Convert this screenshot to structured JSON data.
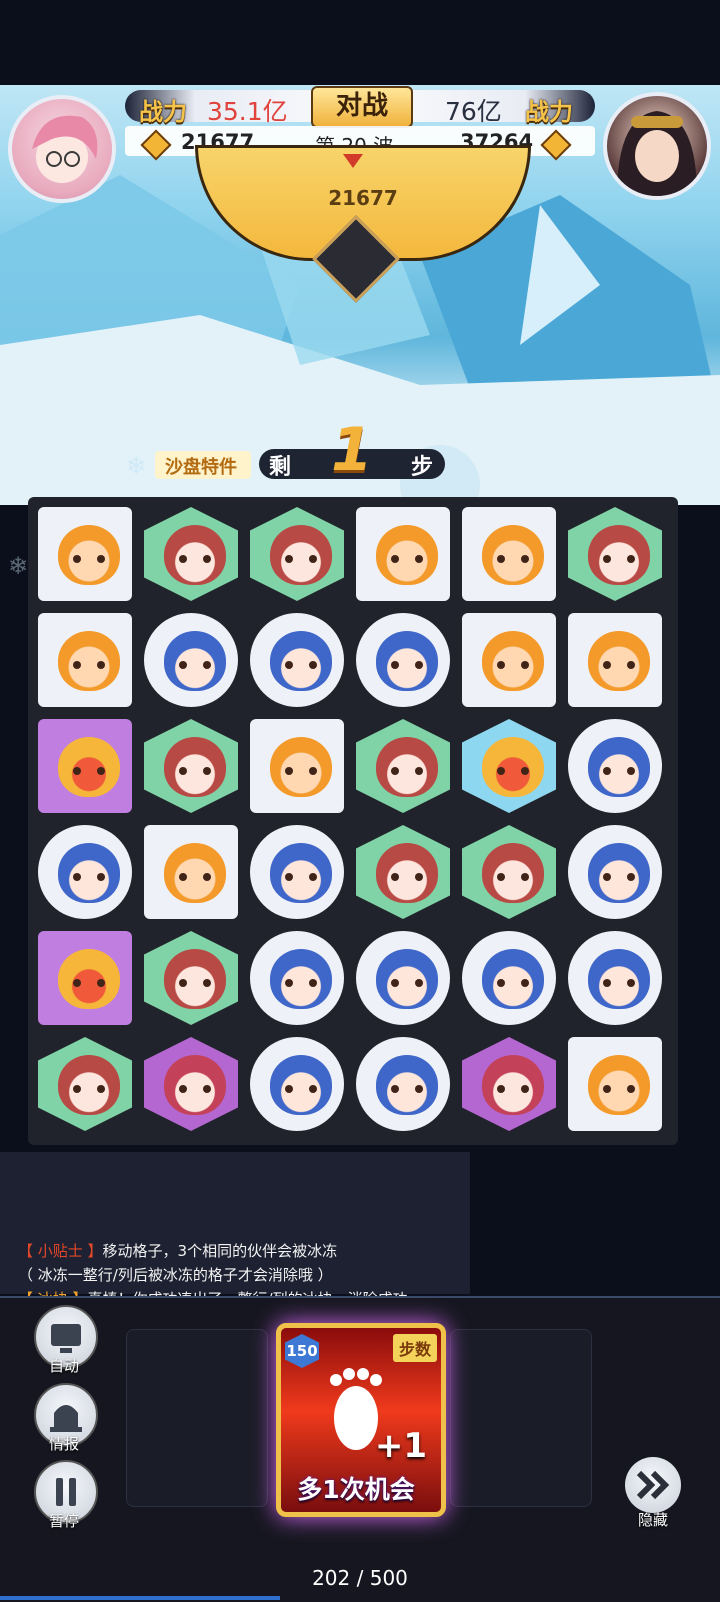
{
  "hud": {
    "power_label_left": "战力",
    "power_left": "35.1亿",
    "vs_label": "对战",
    "power_right": "76亿",
    "power_label_right": "战力",
    "score_left": "21677",
    "wave": "第 20 波",
    "score_right": "37264",
    "shield_value": "21677"
  },
  "steps": {
    "feature_label": "沙盘特件",
    "remaining_prefix": "剩",
    "remaining_count": "1",
    "remaining_suffix": "步"
  },
  "board": {
    "rows": 6,
    "cols": 6,
    "tiles": [
      [
        "orange-sq",
        "red-hex",
        "red-hex",
        "orange-sq",
        "orange-sq",
        "red-hex"
      ],
      [
        "orange-sq",
        "blue-ci",
        "blue-ci",
        "blue-ci",
        "orange-sq",
        "orange-sq"
      ],
      [
        "gold-sq",
        "red-hex",
        "orange-sq",
        "red-hex",
        "gold-hex",
        "blue-ci"
      ],
      [
        "blue-ci",
        "orange-sq",
        "blue-ci",
        "red-hex",
        "red-hex",
        "blue-ci"
      ],
      [
        "gold-sq",
        "red-hex",
        "blue-ci",
        "blue-ci",
        "blue-ci",
        "blue-ci"
      ],
      [
        "red-hex",
        "pink-hex",
        "blue-ci",
        "blue-ci",
        "pink-hex",
        "orange-sq"
      ]
    ],
    "tile_colors": {
      "orange-sq": "#eef1f8",
      "red-hex": "#7fd3a6",
      "blue-ci": "#eef1f8",
      "gold-sq": "#c07ee0",
      "gold-hex": "#8ed7f0",
      "pink-hex": "#b466d1"
    }
  },
  "tips": {
    "tip_label": "【 小贴士 】",
    "tip_text": "移动格子，3个相同的伙伴会被冰冻",
    "tip_text2": "（ 冰冻一整行/列后被冰冻的格子才会消除哦 ）",
    "ice_label": "【 冰块 】",
    "ice_text": "真棒！你成功凑出了一整行/列的冰块，消除成功"
  },
  "controls": {
    "auto_label": "自动",
    "info_label": "情报",
    "pause_label": "暂停",
    "hide_label": "隐藏"
  },
  "card": {
    "level": "150",
    "tag": "步数",
    "bonus": "+1",
    "label": "多1次机会"
  },
  "progress": {
    "current": "202",
    "separator": "/",
    "total": "500"
  },
  "colors": {
    "accent_gold": "#f5c34a",
    "power_red": "#e0433b",
    "card_red": "#f03a1c",
    "glow_purple": "#d86cf7"
  }
}
